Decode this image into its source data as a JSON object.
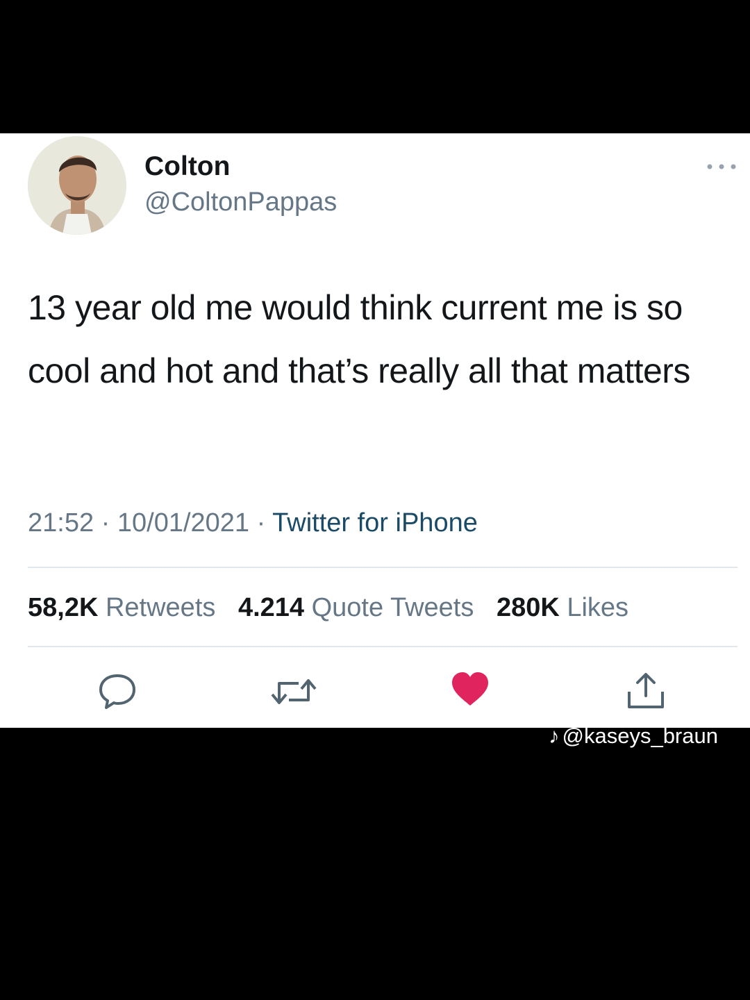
{
  "tweet": {
    "display_name": "Colton",
    "handle": "@ColtonPappas",
    "text": "13 year old me would think current me is so cool and hot and that’s really all that matters",
    "time": "21:52",
    "date": "10/01/2021",
    "source": "Twitter for iPhone",
    "stats": {
      "retweets_count": "58,2K",
      "retweets_label": "Retweets",
      "quotes_count": "4.214",
      "quotes_label": "Quote Tweets",
      "likes_count": "280K",
      "likes_label": "Likes"
    },
    "icons": {
      "reply": "reply-icon",
      "retweet": "retweet-icon",
      "like": "heart-icon",
      "share": "share-icon",
      "more": "more-icon"
    }
  },
  "colors": {
    "heart": "#e0245e",
    "text": "#14171a",
    "muted": "#657786",
    "background": "#000000",
    "card": "#ffffff"
  },
  "watermark": {
    "handle": "@kaseys_braun",
    "icon": "tiktok-icon"
  }
}
